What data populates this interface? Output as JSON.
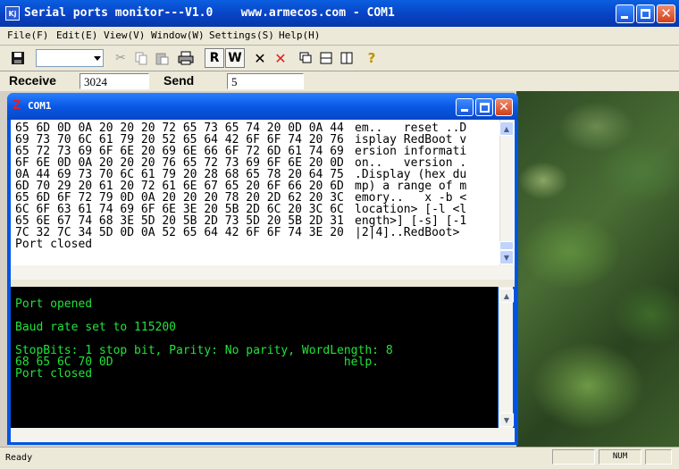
{
  "window": {
    "icon_text": "Kj",
    "title": "Serial ports monitor---V1.0    www.armecos.com - COM1"
  },
  "menu": [
    "File(F)",
    "Edit(E)",
    "View(V)",
    "Window(W)",
    "Settings(S)",
    "Help(H)"
  ],
  "toolbar": {
    "read_label": "R",
    "write_label": "W",
    "help_glyph": "?",
    "icons": [
      "save-icon",
      "port-combo",
      "cut-icon",
      "copy-icon",
      "paste-icon",
      "print-icon",
      "read-button",
      "write-button",
      "clear-icon",
      "delete-icon",
      "cascade-icon",
      "tile-horizontal-icon",
      "tile-vertical-icon",
      "help-icon"
    ]
  },
  "counters": {
    "receive_label": "Receive",
    "receive_value": "3024",
    "send_label": "Send",
    "send_value": "5"
  },
  "child_window": {
    "icon_glyph": "Z",
    "title": "COM1"
  },
  "hex_view": {
    "lines": [
      {
        "hex": "65 6D 0D 0A 20 20 20 72 65 73 65 74 20 0D 0A 44",
        "ascii": "em..   reset ..D"
      },
      {
        "hex": "69 73 70 6C 61 79 20 52 65 64 42 6F 6F 74 20 76",
        "ascii": "isplay RedBoot v"
      },
      {
        "hex": "65 72 73 69 6F 6E 20 69 6E 66 6F 72 6D 61 74 69",
        "ascii": "ersion informati"
      },
      {
        "hex": "6F 6E 0D 0A 20 20 20 76 65 72 73 69 6F 6E 20 0D",
        "ascii": "on..   version ."
      },
      {
        "hex": "0A 44 69 73 70 6C 61 79 20 28 68 65 78 20 64 75",
        "ascii": ".Display (hex du"
      },
      {
        "hex": "6D 70 29 20 61 20 72 61 6E 67 65 20 6F 66 20 6D",
        "ascii": "mp) a range of m"
      },
      {
        "hex": "65 6D 6F 72 79 0D 0A 20 20 20 78 20 2D 62 20 3C",
        "ascii": "emory..   x -b <"
      },
      {
        "hex": "6C 6F 63 61 74 69 6F 6E 3E 20 5B 2D 6C 20 3C 6C",
        "ascii": "location> [-l <l"
      },
      {
        "hex": "65 6E 67 74 68 3E 5D 20 5B 2D 73 5D 20 5B 2D 31",
        "ascii": "ength>] [-s] [-1"
      },
      {
        "hex": "7C 32 7C 34 5D 0D 0A 52 65 64 42 6F 6F 74 3E 20",
        "ascii": "|2|4]..RedBoot> "
      },
      {
        "hex": "Port closed",
        "ascii": ""
      }
    ]
  },
  "terminal": {
    "lines": [
      "Port opened",
      "Baud rate set to 115200",
      "StopBits: 1 stop bit, Parity: No parity, WordLength: 8",
      "68 65 6C 70 0D                                 help.",
      "Port closed"
    ]
  },
  "statusbar": {
    "text": "Ready",
    "num": "NUM"
  }
}
